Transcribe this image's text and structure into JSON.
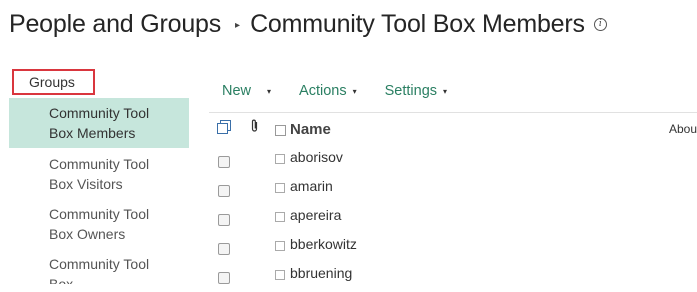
{
  "header": {
    "site_title": "People and Groups",
    "separator": "▸",
    "page_title": "Community Tool Box Members",
    "info_glyph": "i"
  },
  "left_nav": {
    "heading": "Groups",
    "items": [
      {
        "label_line1": "Community Tool",
        "label_line2": "Box Members",
        "selected": true
      },
      {
        "label_line1": "Community Tool",
        "label_line2": "Box Visitors",
        "selected": false
      },
      {
        "label_line1": "Community Tool",
        "label_line2": "Box Owners",
        "selected": false
      },
      {
        "label_line1": "Community Tool",
        "label_line2": "Box",
        "selected": false
      }
    ]
  },
  "toolbar": {
    "new_label": "New",
    "actions_label": "Actions",
    "settings_label": "Settings",
    "dropdown_glyph": "▾"
  },
  "list": {
    "columns": {
      "name": "Name",
      "about": "Abou"
    },
    "rows": [
      {
        "name": "aborisov"
      },
      {
        "name": "amarin"
      },
      {
        "name": "apereira"
      },
      {
        "name": "bberkowitz"
      },
      {
        "name": "bbruening"
      }
    ]
  },
  "icons": {
    "header_doc": "document-stack-icon",
    "header_attach": "paperclip-icon",
    "info": "info-icon",
    "dropdown": "chevron-down-icon"
  },
  "colors": {
    "accent_green": "#2a7f62",
    "selected_bg": "#c6e6dc",
    "highlight_border": "#d9363e"
  }
}
